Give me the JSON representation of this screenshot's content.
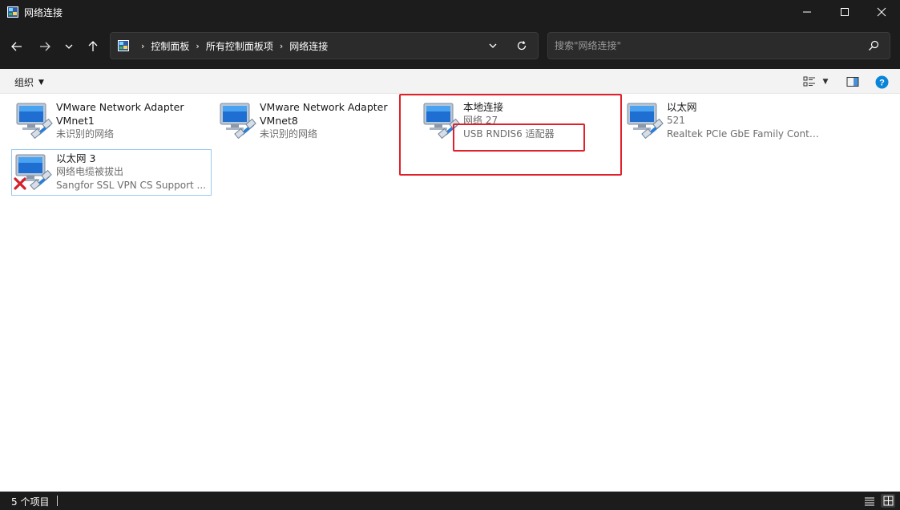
{
  "window": {
    "title": "网络连接"
  },
  "nav": {
    "breadcrumbs": [
      "控制面板",
      "所有控制面板项",
      "网络连接"
    ],
    "search_placeholder": "搜索\"网络连接\""
  },
  "command_bar": {
    "organize_label": "组织"
  },
  "items": [
    {
      "name": "VMware Network Adapter VMnet1",
      "line1": "未识别的网络",
      "line2": "",
      "status": "connected"
    },
    {
      "name": "VMware Network Adapter VMnet8",
      "line1": "未识别的网络",
      "line2": "",
      "status": "connected"
    },
    {
      "name": "本地连接",
      "line1": "网络 27",
      "line2": "USB RNDIS6 适配器",
      "status": "connected"
    },
    {
      "name": "以太网",
      "line1": "521",
      "line2": "Realtek PCIe GbE Family Contr...",
      "status": "connected"
    },
    {
      "name": "以太网 3",
      "line1": "网络电缆被拔出",
      "line2": "Sangfor SSL VPN CS Support ...",
      "status": "disconnected"
    }
  ],
  "status_bar": {
    "item_count": "5 个项目"
  },
  "colors": {
    "chrome_dark": "#1c1c1c",
    "annotation_red": "#e0202a",
    "selection_border": "#99c9ef",
    "help_blue": "#0a84d8"
  }
}
